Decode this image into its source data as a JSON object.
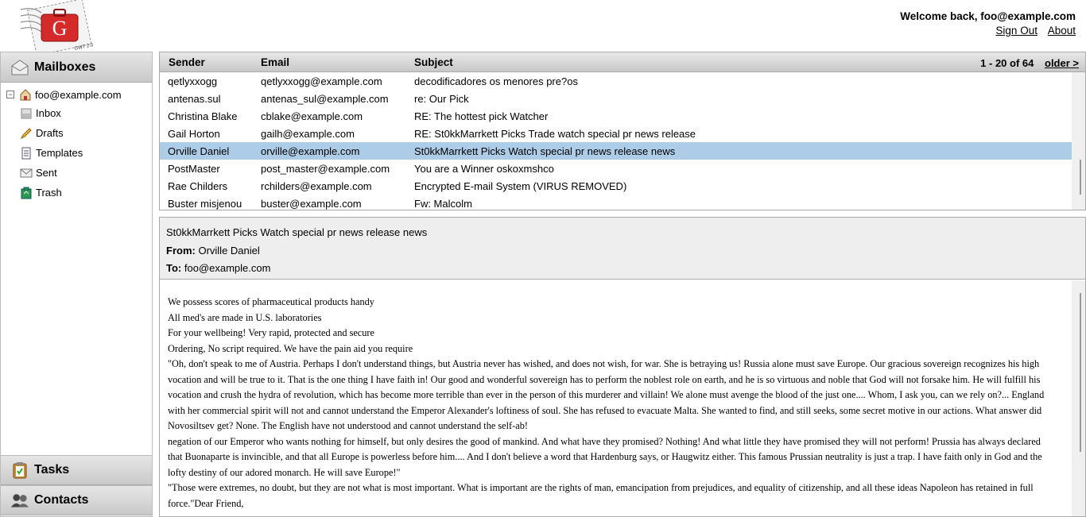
{
  "header": {
    "welcome": "Welcome back, foo@example.com",
    "sign_out": "Sign Out",
    "about": "About",
    "logo_badge": "GWT 2.0"
  },
  "sidebar": {
    "mailboxes_title": "Mailboxes",
    "account": "foo@example.com",
    "folders": [
      {
        "label": "Inbox",
        "icon": "inbox-icon"
      },
      {
        "label": "Drafts",
        "icon": "pencil-icon"
      },
      {
        "label": "Templates",
        "icon": "document-icon"
      },
      {
        "label": "Sent",
        "icon": "envelope-icon"
      },
      {
        "label": "Trash",
        "icon": "trash-icon"
      }
    ],
    "tasks_title": "Tasks",
    "contacts_title": "Contacts"
  },
  "maillist": {
    "columns": {
      "sender": "Sender",
      "email": "Email",
      "subject": "Subject"
    },
    "range": "1 - 20 of 64",
    "older": "older >",
    "rows": [
      {
        "sender": "qetlyxxogg",
        "email": "qetlyxxogg@example.com",
        "subject": "decodificadores os menores pre?os"
      },
      {
        "sender": "antenas.sul",
        "email": "antenas_sul@example.com",
        "subject": "re: Our Pick"
      },
      {
        "sender": "Christina Blake",
        "email": "cblake@example.com",
        "subject": "RE: The hottest pick Watcher"
      },
      {
        "sender": "Gail Horton",
        "email": "gailh@example.com",
        "subject": "RE: St0kkMarrkett Picks Trade watch special pr news release"
      },
      {
        "sender": "Orville Daniel",
        "email": "orville@example.com",
        "subject": "St0kkMarrkett Picks Watch special pr news release news",
        "selected": true
      },
      {
        "sender": "PostMaster",
        "email": "post_master@example.com",
        "subject": "You are a Winner oskoxmshco"
      },
      {
        "sender": "Rae Childers",
        "email": "rchilders@example.com",
        "subject": "Encrypted E-mail System (VIRUS REMOVED)"
      },
      {
        "sender": "Buster misjenou",
        "email": "buster@example.com",
        "subject": "Fw: Malcolm"
      }
    ]
  },
  "detail": {
    "subject": "St0kkMarrkett Picks Watch special pr news release news",
    "from_label": "From:",
    "from": "Orville Daniel",
    "to_label": "To:",
    "to": "foo@example.com",
    "body": [
      "We possess scores of pharmaceutical products handy",
      "All med's are made in U.S. laboratories",
      "For your wellbeing! Very rapid, protected and secure",
      "Ordering, No script required. We have the pain aid you require",
      "\"Oh, don't speak to me of Austria. Perhaps I don't understand things, but Austria never has wished, and does not wish, for war. She is betraying us! Russia alone must save Europe. Our gracious sovereign recognizes his high vocation and will be true to it. That is the one thing I have faith in! Our good and wonderful sovereign has to perform the noblest role on earth, and he is so virtuous and noble that God will not forsake him. He will fulfill his vocation and crush the hydra of revolution, which has become more terrible than ever in the person of this murderer and villain! We alone must avenge the blood of the just one.... Whom, I ask you, can we rely on?... England with her commercial spirit will not and cannot understand the Emperor Alexander's loftiness of soul. She has refused to evacuate Malta. She wanted to find, and still seeks, some secret motive in our actions. What answer did Novosiltsev get? None. The English have not understood and cannot understand the self-ab!",
      "negation of our Emperor who wants nothing for himself, but only desires the good of mankind. And what have they promised? Nothing! And what little they have promised they will not perform! Prussia has always declared that Buonaparte is invincible, and that all Europe is powerless before him.... And I don't believe a word that Hardenburg says, or Haugwitz either. This famous Prussian neutrality is just a trap. I have faith only in God and the lofty destiny of our adored monarch. He will save Europe!\"",
      "\"Those were extremes, no doubt, but they are not what is most important. What is important are the rights of man, emancipation from prejudices, and equality of citizenship, and all these ideas Napoleon has retained in full force.\"Dear Friend,"
    ]
  }
}
